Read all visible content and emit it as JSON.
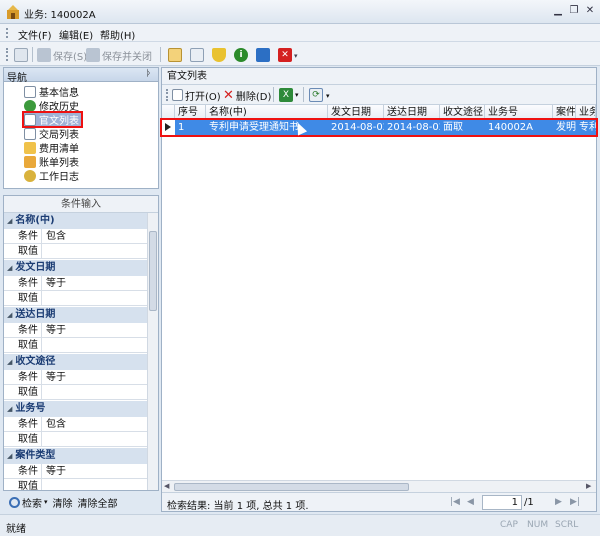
{
  "window": {
    "title": "业务: 140002A"
  },
  "menubar": {
    "file": "文件(F)",
    "edit": "编辑(E)",
    "help": "帮助(H)"
  },
  "toolbar": {
    "save": "保存(S)",
    "save_close": "保存并关闭"
  },
  "nav": {
    "title": "导航",
    "items": [
      {
        "label": "基本信息"
      },
      {
        "label": "修改历史"
      },
      {
        "label": "官文列表"
      },
      {
        "label": "交局列表"
      },
      {
        "label": "费用清单"
      },
      {
        "label": "账单列表"
      },
      {
        "label": "工作日志"
      }
    ]
  },
  "conditions": {
    "title": "条件输入",
    "groups": [
      {
        "name": "名称(中)",
        "cond_label": "条件",
        "cond_value": "包含",
        "val_label": "取值"
      },
      {
        "name": "发文日期",
        "cond_label": "条件",
        "cond_value": "等于",
        "val_label": "取值"
      },
      {
        "name": "送达日期",
        "cond_label": "条件",
        "cond_value": "等于",
        "val_label": "取值"
      },
      {
        "name": "收文途径",
        "cond_label": "条件",
        "cond_value": "等于",
        "val_label": "取值"
      },
      {
        "name": "业务号",
        "cond_label": "条件",
        "cond_value": "包含",
        "val_label": "取值"
      },
      {
        "name": "案件类型",
        "cond_label": "条件",
        "cond_value": "等于",
        "val_label": "取值"
      }
    ]
  },
  "search_bar": {
    "search": "检索",
    "clear": "清除",
    "clear_all": "清除全部"
  },
  "list": {
    "title": "官文列表",
    "open": "打开(O)",
    "delete": "删除(D)",
    "columns": [
      "序号",
      "名称(中)",
      "发文日期",
      "送达日期",
      "收文途径",
      "业务号",
      "案件",
      "业务"
    ],
    "rows": [
      [
        "1",
        "专利申请受理通知书",
        "2014-08-02",
        "2014-08-02",
        "面取",
        "140002A",
        "发明",
        "专利"
      ]
    ],
    "result": "检索结果: 当前 1 项, 总共 1 项.",
    "page": "1",
    "page_total": "/1"
  },
  "status": {
    "text": "就绪",
    "cap": "CAP",
    "num": "NUM",
    "scrl": "SCRL"
  },
  "colors": {
    "selected_row": "#3f8ae6",
    "highlight_box": "#e11111"
  }
}
